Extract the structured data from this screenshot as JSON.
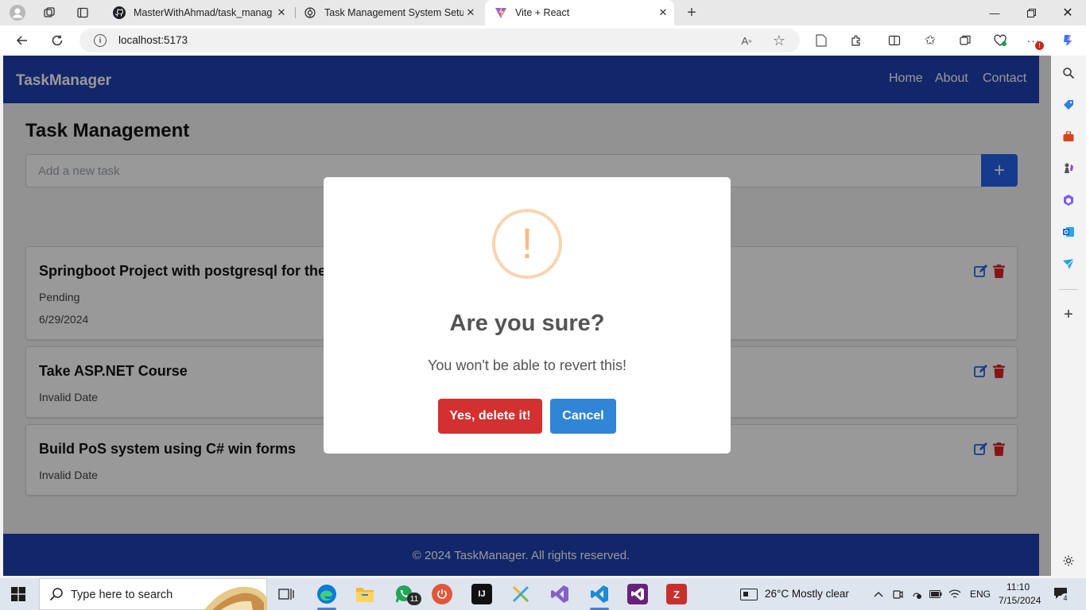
{
  "browser": {
    "tabs": [
      {
        "title": "MasterWithAhmad/task_manage",
        "active": false
      },
      {
        "title": "Task Management System Setup",
        "active": false
      },
      {
        "title": "Vite + React",
        "active": true
      }
    ],
    "url": "localhost:5173"
  },
  "app": {
    "brand": "TaskManager",
    "nav": [
      "Home",
      "About",
      "Contact"
    ],
    "page_title": "Task Management",
    "input_placeholder": "Add a new task",
    "add_button": "+",
    "tasks": [
      {
        "title": "Springboot Project with postgresql for the d",
        "status": "Pending",
        "date": "6/29/2024"
      },
      {
        "title": "Take ASP.NET Course",
        "date": "Invalid Date"
      },
      {
        "title": "Build PoS system using C# win forms",
        "date": "Invalid Date"
      }
    ],
    "footer": "© 2024 TaskManager. All rights reserved."
  },
  "dialog": {
    "icon": "!",
    "title": "Are you sure?",
    "text": "You won't be able to revert this!",
    "confirm": "Yes, delete it!",
    "cancel": "Cancel"
  },
  "taskbar": {
    "search_placeholder": "Type here to search",
    "whatsapp_badge": "11",
    "weather": "26°C  Mostly clear",
    "lang": "ENG",
    "time": "11:10",
    "date": "7/15/2024",
    "notifications": "4"
  },
  "colors": {
    "nav_bg": "#1e40af",
    "add_button": "#2563eb",
    "confirm": "#d33030",
    "cancel": "#3085d6",
    "warning": "#f8bb86"
  }
}
